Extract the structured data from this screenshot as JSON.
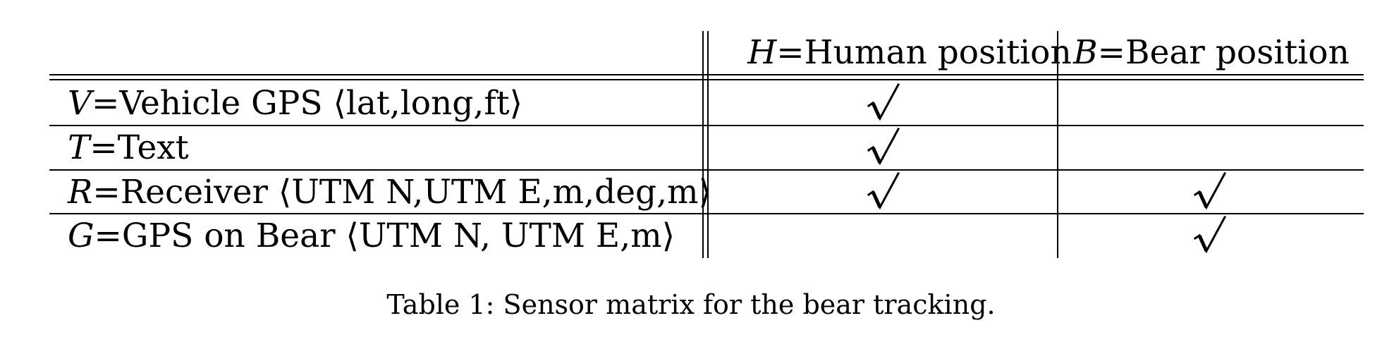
{
  "table": {
    "header": {
      "col_h_var": "H",
      "col_h_text": " =Human position",
      "col_b_var": "B",
      "col_b_text": " =Bear position"
    },
    "rows": [
      {
        "var": "V",
        "text": " =Vehicle GPS ⟨lat,long,ft⟩",
        "human": true,
        "bear": false
      },
      {
        "var": "T",
        "text": " =Text",
        "human": true,
        "bear": false
      },
      {
        "var": "R",
        "text": " =Receiver ⟨UTM N,UTM E,m,deg,m⟩",
        "human": true,
        "bear": true
      },
      {
        "var": "G",
        "text": "=GPS on Bear ⟨UTM N, UTM E,m⟩",
        "human": false,
        "bear": true
      }
    ],
    "check_icon": "check-icon"
  },
  "caption": "Table 1: Sensor matrix for the bear tracking."
}
